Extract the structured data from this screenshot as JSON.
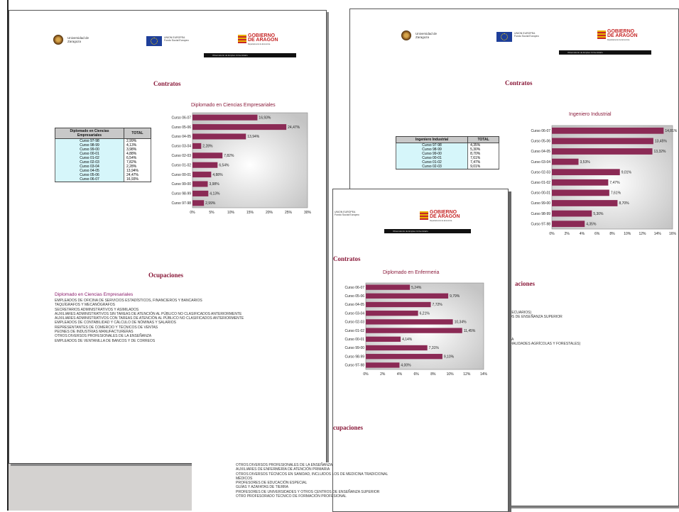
{
  "logos": {
    "unizar": "Universidad de Zaragoza",
    "eu_title": "UNION EUROPEA",
    "eu_sub": "Fondo Social Europeo",
    "ga_title": "GOBIERNO DE ARAGON",
    "ga_sub": "Departamento de Economía",
    "blackbar": "Observatorio de Empleo Universitario"
  },
  "page1": {
    "contratos": "Contratos",
    "table_headers": [
      "Diplomado en Ciencias Empresariales",
      "TOTAL"
    ],
    "table_rows": [
      [
        "Curso 97-98",
        "2,99%"
      ],
      [
        "Curso 98-99",
        "4,13%"
      ],
      [
        "Curso 99-00",
        "3,98%"
      ],
      [
        "Curso 00-01",
        "4,88%"
      ],
      [
        "Curso 01-02",
        "6,54%"
      ],
      [
        "Curso 02-03",
        "7,82%"
      ],
      [
        "Curso 03-04",
        "2,28%"
      ],
      [
        "Curso 04-05",
        "13,94%"
      ],
      [
        "Curso 05-06",
        "24,47%"
      ],
      [
        "Curso 06-07",
        "16,93%"
      ]
    ],
    "ocupaciones": "Ocupaciones",
    "occ_head": "Diplomado en Ciencias Empresariales",
    "occ_items": [
      "EMPLEADOS DE OFICINA DE SERVICIOS ESTADÍSTICOS, FINANCIEROS Y BANCARIOS",
      "TAQUÍGRAFOS Y MECANÓGRAFOS",
      "SECRETARIOS ADMINISTRATIVOS Y ASIMILADOS",
      "AUXILIARES ADMINISTRATIVOS SIN TAREAS DE ATENCIÓN AL PÚBLICO NO CLASIFICADOS ANTERIORMENTE",
      "AUXILIARES ADMINISTRATIVOS CON TAREAS DE ATENCIÓN AL PÚBLICO NO CLASIFICADOS ANTERIORMENTE",
      "EMPLEADOS DE CONTABILIDAD Y CÁLCULO DE NÓMINAS Y SALARIOS",
      "REPRESENTANTES DE COMERCIO Y TÉCNICOS DE VENTAS",
      "PEONES DE INDUSTRIAS MANUFACTURERAS",
      "OTROS DIVERSOS PROFESIONALES DE LA ENSEÑANZA",
      "EMPLEADOS DE VENTANILLA DE BANCOS Y DE CORREOS"
    ]
  },
  "page2": {
    "contratos": "Contratos",
    "table_headers": [
      "Ingeniero Industrial",
      "TOTAL"
    ],
    "table_rows": [
      [
        "Curso 97-98",
        "4,35%"
      ],
      [
        "Curso 98-99",
        "5,30%"
      ],
      [
        "Curso 99-00",
        "8,70%"
      ],
      [
        "Curso 00-01",
        "7,61%"
      ],
      [
        "Curso 01-02",
        "7,47%"
      ],
      [
        "Curso 02-03",
        "9,01%"
      ]
    ],
    "ocupaciones": "aciones",
    "occ_items": [
      "PECUARIOS)",
      "OS DE ENSEÑANZA SUPERIOR",
      "ZA",
      "DIALIDADES AGRÍCOLAS Y FORESTALES)"
    ]
  },
  "page3": {
    "contratos": "Contratos",
    "ocupaciones": "cupaciones",
    "occ_items": [
      "OTROS DIVERSOS PROFESIONALES DE LA ENSEÑANZA",
      "AUXILIARES DE ENFERMERÍA DE ATENCIÓN PRIMARIA",
      "OTROS DIVERSOS TÉCNICOS EN SANIDAD, INCLUIDOS LOS DE MEDICINA TRADICIONAL",
      "MÉDICOS",
      "PROFESORES DE EDUCACIÓN ESPECIAL",
      "GUÍAS Y AZAFATAS DE TIERRA",
      "PROFESORES DE UNIVERSIDADES Y OTROS CENTROS DE ENSEÑANZA SUPERIOR",
      "OTRO PROFESORADO TÉCNICO DE FORMACIÓN PROFESIONAL"
    ]
  },
  "colors": {
    "bar": "#8b2a55",
    "title": "#8a1a3a"
  },
  "chart_data": [
    {
      "type": "bar",
      "orientation": "horizontal",
      "title": "Diplomado en Ciencias Empresariales",
      "categories": [
        "Curso 06-07",
        "Curso 05-06",
        "Curso 04-05",
        "Curso 03-04",
        "Curso 02-03",
        "Curso 01-02",
        "Curso 00-01",
        "Curso 99-00",
        "Curso 98-99",
        "Curso 97-98"
      ],
      "values": [
        16.93,
        24.47,
        13.94,
        2.28,
        7.82,
        6.54,
        4.88,
        3.98,
        4.13,
        2.99
      ],
      "labels": [
        "16,93%",
        "24,47%",
        "13,94%",
        "2,28%",
        "7,82%",
        "6,54%",
        "4,88%",
        "3,98%",
        "4,13%",
        "2,99%"
      ],
      "xlim": [
        0,
        30
      ],
      "xticks": [
        "0%",
        "5%",
        "10%",
        "15%",
        "20%",
        "25%",
        "30%"
      ]
    },
    {
      "type": "bar",
      "orientation": "horizontal",
      "title": "Ingeniero Industrial",
      "categories": [
        "Curso 06-07",
        "Curso 05-06",
        "Curso 04-05",
        "Curso 03-04",
        "Curso 02-03",
        "Curso 01-02",
        "Curso 00-01",
        "Curso 99-00",
        "Curso 98-99",
        "Curso 97-98"
      ],
      "values": [
        14.81,
        13.45,
        13.32,
        3.53,
        9.01,
        7.47,
        7.61,
        8.7,
        5.3,
        4.35
      ],
      "labels": [
        "14,81%",
        "13,45%",
        "13,32%",
        "3,53%",
        "9,01%",
        "7,47%",
        "7,61%",
        "8,70%",
        "5,30%",
        "4,35%"
      ],
      "xlim": [
        0,
        16
      ],
      "xticks": [
        "0%",
        "2%",
        "4%",
        "6%",
        "8%",
        "10%",
        "12%",
        "14%",
        "16%"
      ]
    },
    {
      "type": "bar",
      "orientation": "horizontal",
      "title": "Diplomado en Enfermeria",
      "categories": [
        "Curso 06-07",
        "Curso 05-06",
        "Curso 04-05",
        "Curso 03-04",
        "Curso 02-03",
        "Curso 01-02",
        "Curso 00-01",
        "Curso 99-00",
        "Curso 98-99",
        "Curso 97-98"
      ],
      "values": [
        5.24,
        9.79,
        7.72,
        6.21,
        10.34,
        11.45,
        4.14,
        7.31,
        9.1,
        4.0
      ],
      "labels": [
        "5,24%",
        "9,79%",
        "7,72%",
        "6,21%",
        "10,34%",
        "11,45%",
        "4,14%",
        "7,31%",
        "9,10%",
        "4,00%"
      ],
      "xlim": [
        0,
        14
      ],
      "xticks": [
        "0%",
        "2%",
        "4%",
        "6%",
        "8%",
        "10%",
        "12%",
        "14%"
      ]
    }
  ]
}
